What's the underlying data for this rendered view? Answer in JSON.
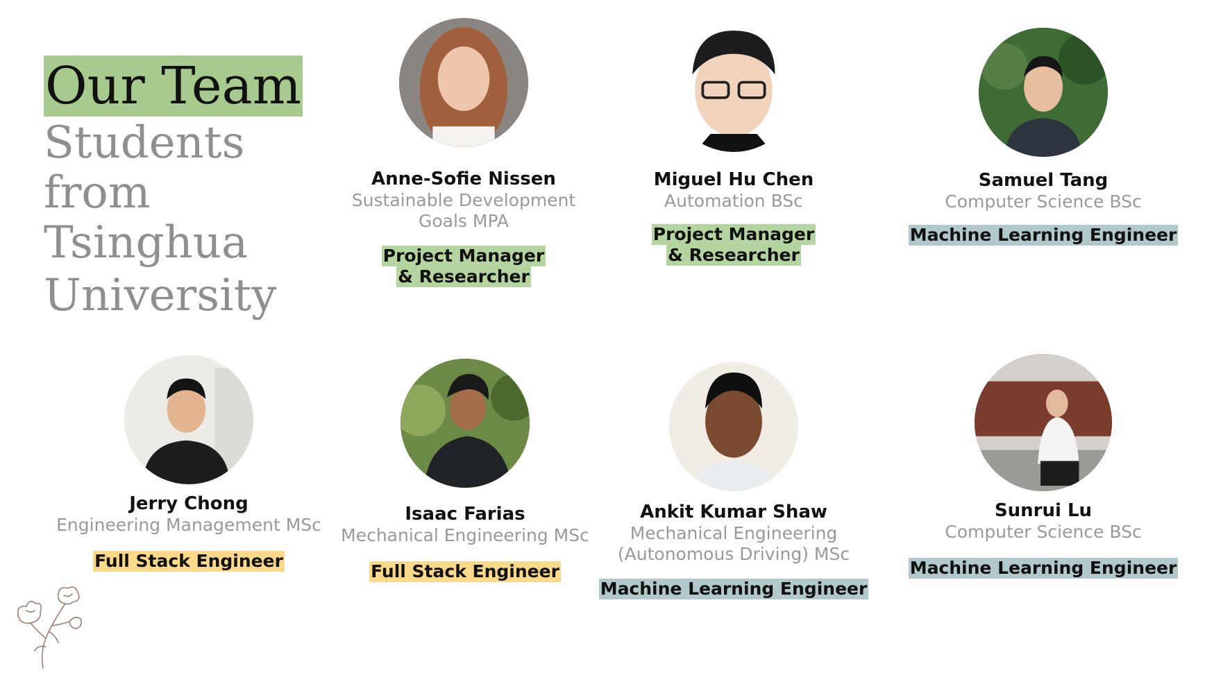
{
  "header": {
    "title": "Our Team",
    "subtitle_lines": [
      "Students",
      "from",
      "Tsinghua",
      "University"
    ]
  },
  "members": [
    {
      "name": "Anne-Sofie Nissen",
      "degree_lines": [
        "Sustainable Development",
        "Goals MPA"
      ],
      "role_lines": [
        "Project Manager",
        "& Researcher"
      ],
      "role_color": "#b5d5a0"
    },
    {
      "name": "Miguel Hu Chen",
      "degree_lines": [
        "Automation BSc"
      ],
      "role_lines": [
        "Project Manager",
        "& Researcher"
      ],
      "role_color": "#b5d5a0"
    },
    {
      "name": "Samuel Tang",
      "degree_lines": [
        "Computer Science BSc"
      ],
      "role_lines": [
        "Machine Learning Engineer"
      ],
      "role_color": "#b2c9cb"
    },
    {
      "name": "Jerry Chong",
      "degree_lines": [
        "Engineering Management MSc"
      ],
      "role_lines": [
        "Full Stack Engineer"
      ],
      "role_color": "#fbd98a"
    },
    {
      "name": "Isaac Farias",
      "degree_lines": [
        "Mechanical Engineering MSc"
      ],
      "role_lines": [
        "Full Stack Engineer"
      ],
      "role_color": "#fbd98a"
    },
    {
      "name": "Ankit Kumar Shaw",
      "degree_lines": [
        "Mechanical Engineering",
        "(Autonomous Driving) MSc"
      ],
      "role_lines": [
        "Machine Learning  Engineer"
      ],
      "role_color": "#b2c9cb"
    },
    {
      "name": "Sunrui Lu",
      "degree_lines": [
        "Computer Science BSc"
      ],
      "role_lines": [
        "Machine Learning  Engineer"
      ],
      "role_color": "#b2c9cb"
    }
  ],
  "colors": {
    "title_highlight": "#a7cb8f",
    "subtitle_text": "#8f8f8f",
    "degree_text": "#999999"
  },
  "decorations": {
    "flower": "flower-line-drawing-icon"
  }
}
